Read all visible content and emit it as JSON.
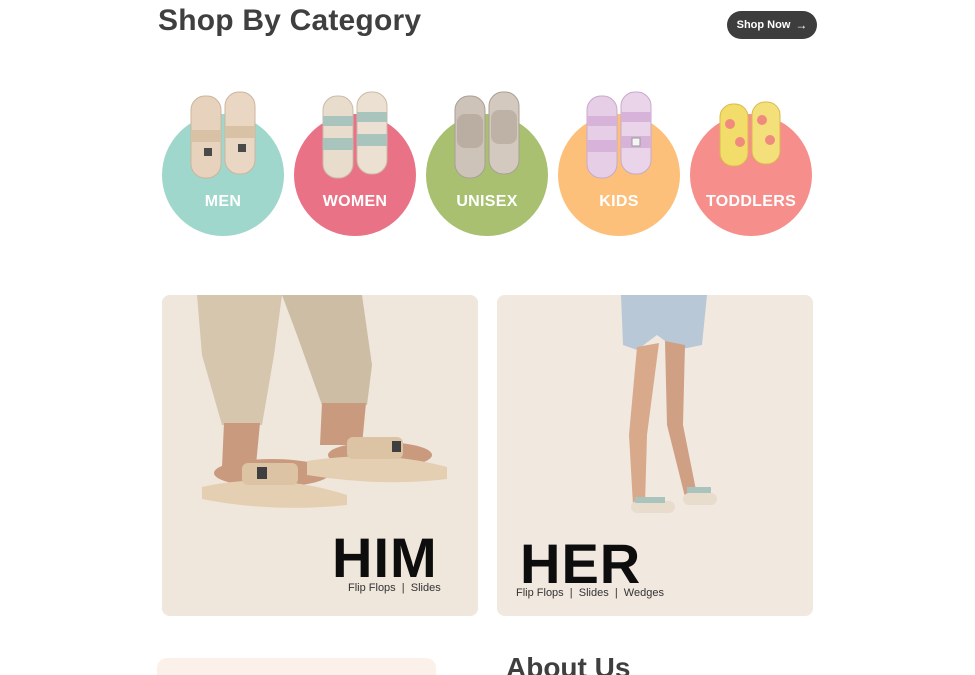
{
  "header": {
    "title": "Shop By Category",
    "shop_now_label": "Shop Now",
    "arrow_icon": "→"
  },
  "categories": [
    {
      "label": "MEN",
      "color": "#9fd7cc",
      "icon": "sandal-icon"
    },
    {
      "label": "WOMEN",
      "color": "#e97286",
      "icon": "sandal-icon"
    },
    {
      "label": "UNISEX",
      "color": "#a9c071",
      "icon": "slide-icon"
    },
    {
      "label": "KIDS",
      "color": "#fcc07a",
      "icon": "sandal-icon"
    },
    {
      "label": "TODDLERS",
      "color": "#f68f8c",
      "icon": "flip-flop-icon"
    }
  ],
  "features": {
    "him": {
      "title": "HIM",
      "subtitle": "Flip Flops  |  Slides"
    },
    "her": {
      "title": "HER",
      "subtitle": "Flip Flops  |  Slides  |  Wedges"
    }
  },
  "about": {
    "title": "About Us"
  }
}
